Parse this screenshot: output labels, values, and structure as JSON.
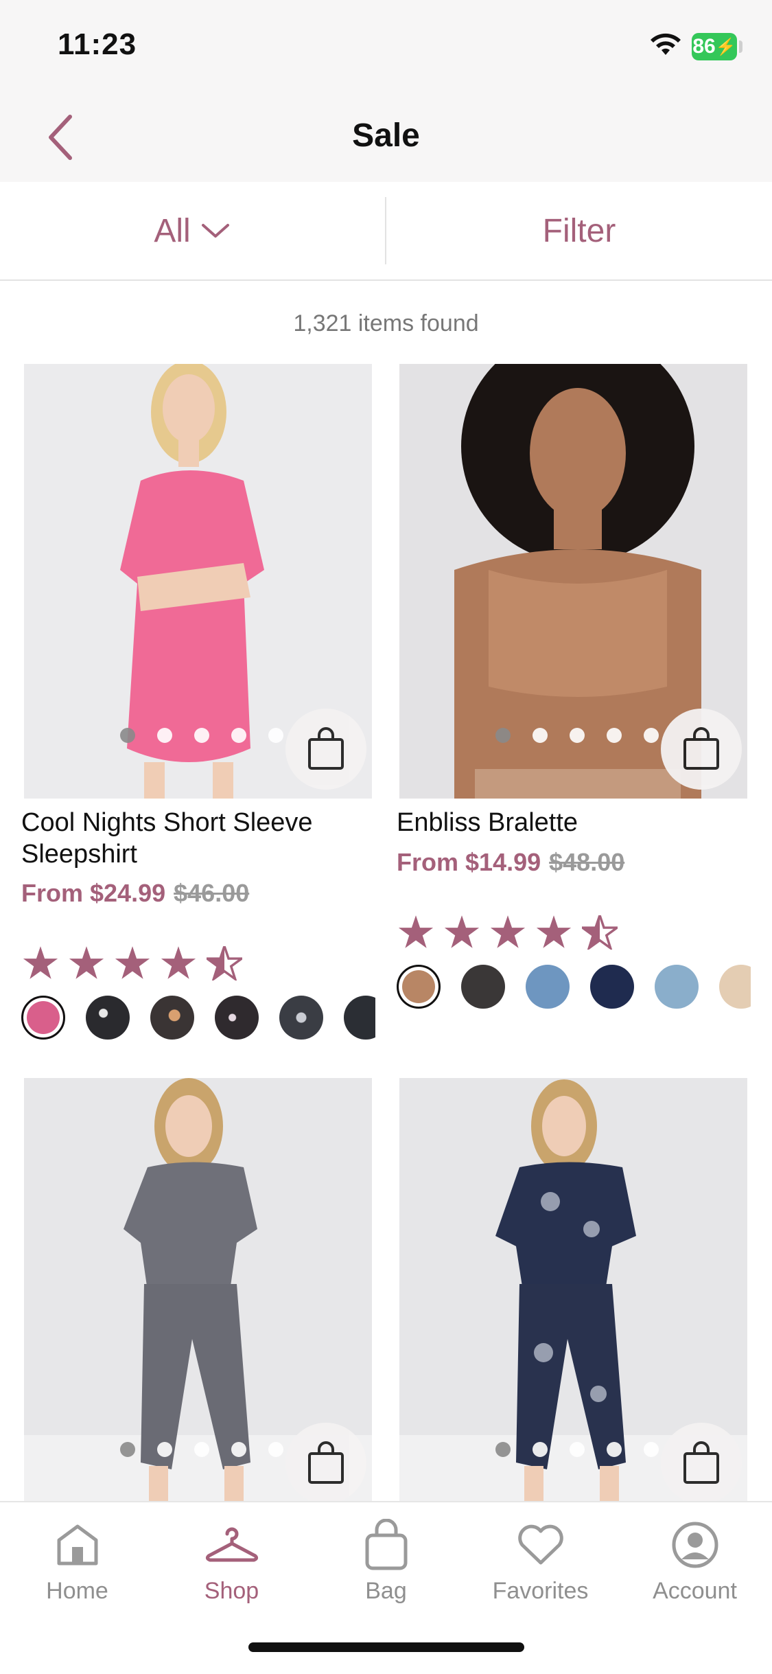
{
  "status_bar": {
    "time": "11:23",
    "battery": "86"
  },
  "nav": {
    "title": "Sale"
  },
  "toolbar": {
    "category_label": "All",
    "filter_label": "Filter"
  },
  "results": {
    "count_text": "1,321 items found"
  },
  "products": [
    {
      "name": "Cool Nights Short Sleeve Sleepshirt",
      "price": "From $24.99",
      "original_price": "$46.00",
      "rating": 4.5,
      "swatch_colors": [
        "#d95f8b",
        "#2a2a2e",
        "#3a3434",
        "#2f2a2e",
        "#3a3d44",
        "#2b2e34"
      ]
    },
    {
      "name": "Enbliss Bralette",
      "price": "From $14.99",
      "original_price": "$48.00",
      "rating": 4.5,
      "swatch_colors": [
        "#b88665",
        "#3a3737",
        "#6e96c0",
        "#1f2b4f",
        "#8aaecb",
        "#e4cdb3"
      ]
    },
    {
      "name": "",
      "price": "",
      "original_price": ""
    },
    {
      "name": "",
      "price": "",
      "original_price": ""
    }
  ],
  "tab_bar": {
    "items": [
      {
        "label": "Home",
        "icon": "home-icon"
      },
      {
        "label": "Shop",
        "icon": "hanger-icon",
        "active": true
      },
      {
        "label": "Bag",
        "icon": "bag-icon"
      },
      {
        "label": "Favorites",
        "icon": "heart-icon"
      },
      {
        "label": "Account",
        "icon": "account-icon"
      }
    ]
  },
  "colors": {
    "accent": "#a4607a",
    "text": "#111111",
    "muted": "#8f8f8f"
  }
}
